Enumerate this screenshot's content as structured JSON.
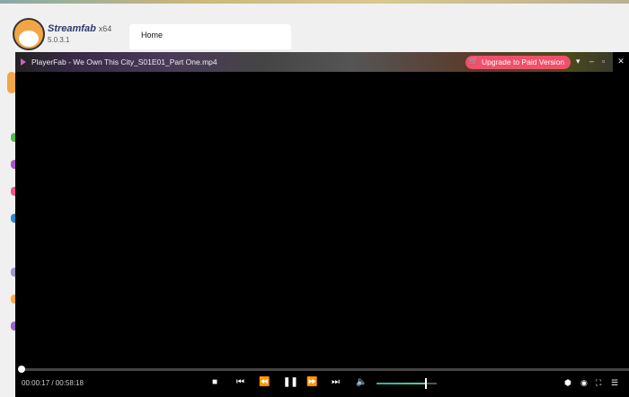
{
  "app": {
    "name": "Streamfab",
    "arch": "x64",
    "version": "5.0.3.1",
    "tab": "Home"
  },
  "player": {
    "title": "PlayerFab - We Own This City_S01E01_Part One.mp4",
    "upgrade_label": "Upgrade to Paid Version",
    "time": "00:00:17 / 00:58:18",
    "progress_percent": 0.5,
    "volume_percent": 80,
    "icons": [
      "stop-icon",
      "previous-icon",
      "rewind-icon",
      "pause-icon",
      "fast-forward-icon",
      "next-icon",
      "volume-icon",
      "3d-icon",
      "eye-icon",
      "fullscreen-icon",
      "playlist-icon"
    ]
  },
  "colors": {
    "upgrade": "#f0506a"
  }
}
